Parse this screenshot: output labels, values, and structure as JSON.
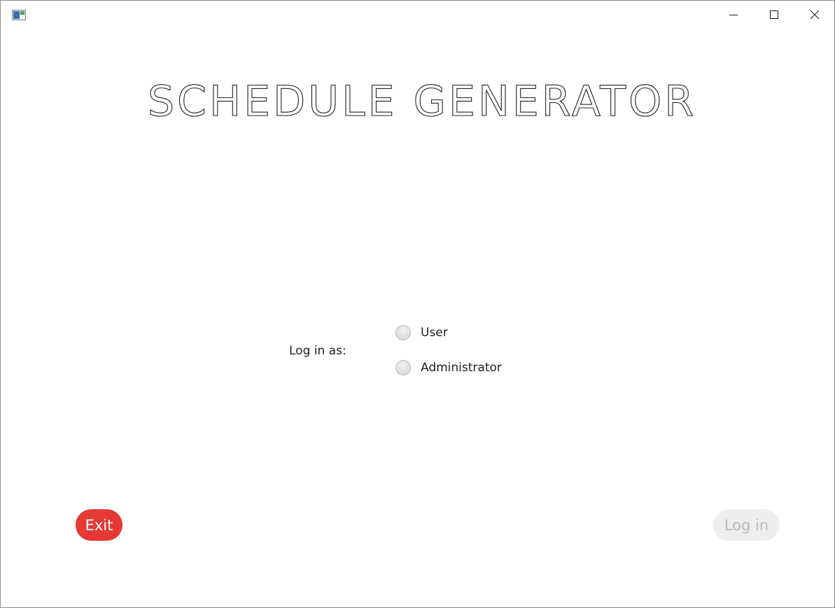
{
  "window": {
    "controls": {
      "minimize": "minimize-icon",
      "maximize": "maximize-icon",
      "close": "close-icon"
    }
  },
  "header": {
    "title": "SCHEDULE GENERATOR"
  },
  "login": {
    "label": "Log in as:",
    "options": [
      {
        "label": "User",
        "selected": false
      },
      {
        "label": "Administrator",
        "selected": false
      }
    ]
  },
  "actions": {
    "exit_label": "Exit",
    "login_label": "Log in",
    "login_enabled": false
  },
  "colors": {
    "exit_button": "#e53935",
    "login_button_disabled_bg": "#eeeeee",
    "login_button_disabled_text": "#b8b8b8"
  }
}
